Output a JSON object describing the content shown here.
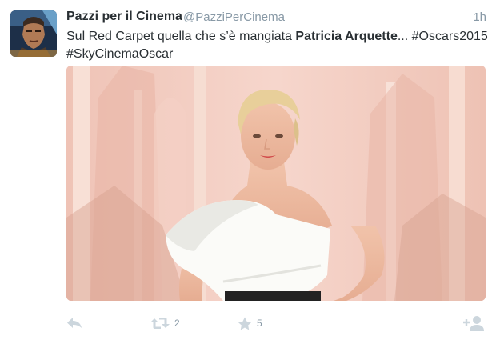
{
  "tweet": {
    "fullname": "Pazzi per il Cinema",
    "username": "@PazziPerCinema",
    "time": "1h",
    "text_before": "Sul Red Carpet quella che s’è mangiata ",
    "text_bold": "Patricia Arquette",
    "text_after": "... #Oscars2015",
    "text_line2": "#SkyCinemaOscar",
    "retweet_count": "2",
    "favorite_count": "5"
  },
  "colors": {
    "text": "#292f33",
    "secondary": "#8899a6",
    "icon": "#ccd6dd",
    "media_background": "#f2c8bd"
  },
  "icons": {
    "reply": "reply-icon",
    "retweet": "retweet-icon",
    "favorite": "star-icon",
    "follow": "add-user-icon"
  }
}
